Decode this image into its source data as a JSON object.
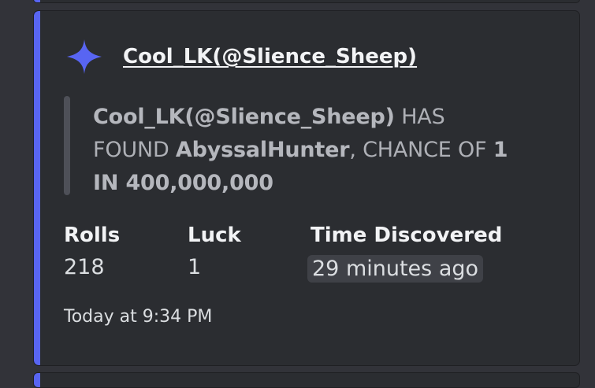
{
  "author": {
    "name": "Cool_LK(@Slience_Sheep)",
    "icon": "sparkle-icon"
  },
  "description": {
    "player": "Cool_LK(@Slience_Sheep)",
    "has_found": " HAS FOUND ",
    "item": "AbyssalHunter",
    "chance_of": ", CHANCE OF ",
    "odds": "1 IN 400,000,000"
  },
  "fields": [
    {
      "label": "Rolls",
      "value": "218"
    },
    {
      "label": "Luck",
      "value": "1"
    },
    {
      "label": "Time Discovered",
      "value": "29 minutes ago"
    }
  ],
  "footer": {
    "timestamp": "Today at 9:34 PM"
  },
  "colors": {
    "accent": "#5865f2",
    "background": "#323339",
    "embed": "#2b2d31"
  }
}
